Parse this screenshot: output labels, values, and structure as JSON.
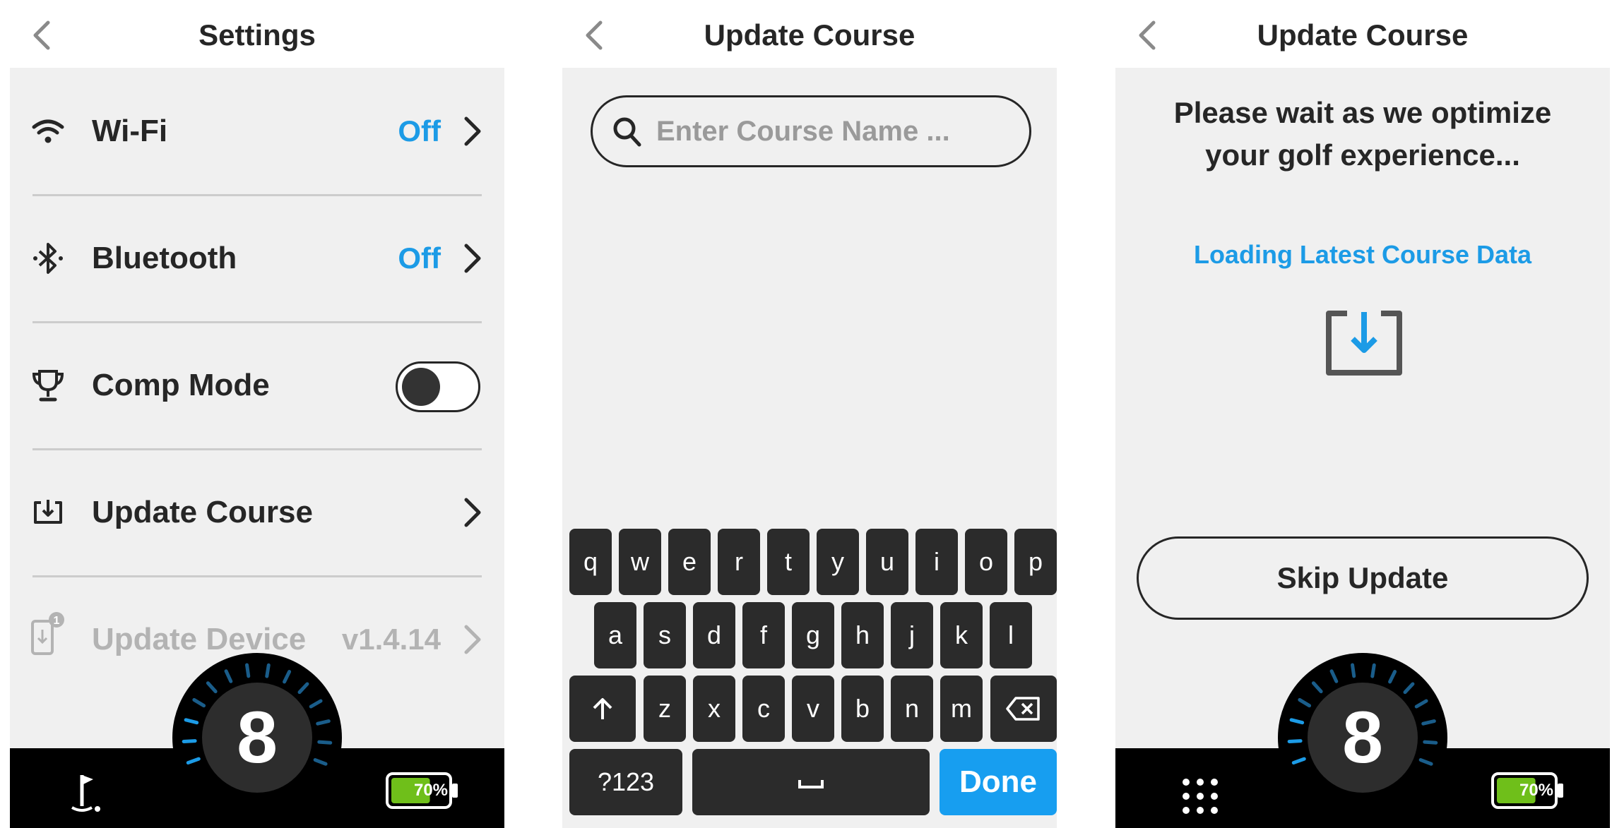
{
  "settings": {
    "title": "Settings",
    "items": [
      {
        "label": "Wi-Fi",
        "value": "Off"
      },
      {
        "label": "Bluetooth",
        "value": "Off"
      },
      {
        "label": "Comp Mode"
      },
      {
        "label": "Update Course"
      },
      {
        "label": "Update Device",
        "value": "v1.4.14",
        "badge": "1"
      }
    ],
    "comp_mode_on": false
  },
  "search": {
    "title": "Update Course",
    "placeholder": "Enter Course Name ..."
  },
  "keyboard": {
    "row1": [
      "q",
      "w",
      "e",
      "r",
      "t",
      "y",
      "u",
      "i",
      "o",
      "p"
    ],
    "row2": [
      "a",
      "s",
      "d",
      "f",
      "g",
      "h",
      "j",
      "k",
      "l"
    ],
    "row3": [
      "z",
      "x",
      "c",
      "v",
      "b",
      "n",
      "m"
    ],
    "numbers_label": "?123",
    "done_label": "Done"
  },
  "loading": {
    "title": "Update Course",
    "message_line1": "Please wait as we optimize",
    "message_line2": "your golf experience...",
    "status": "Loading Latest Course Data",
    "skip_label": "Skip Update"
  },
  "status_bar": {
    "hole_number": "8",
    "battery": "70%",
    "battery_level": 0.7
  },
  "colors": {
    "accent": "#1c9be6",
    "background": "#f0f0f0",
    "bar": "#000000",
    "battery_fill": "#6fbf1a"
  }
}
